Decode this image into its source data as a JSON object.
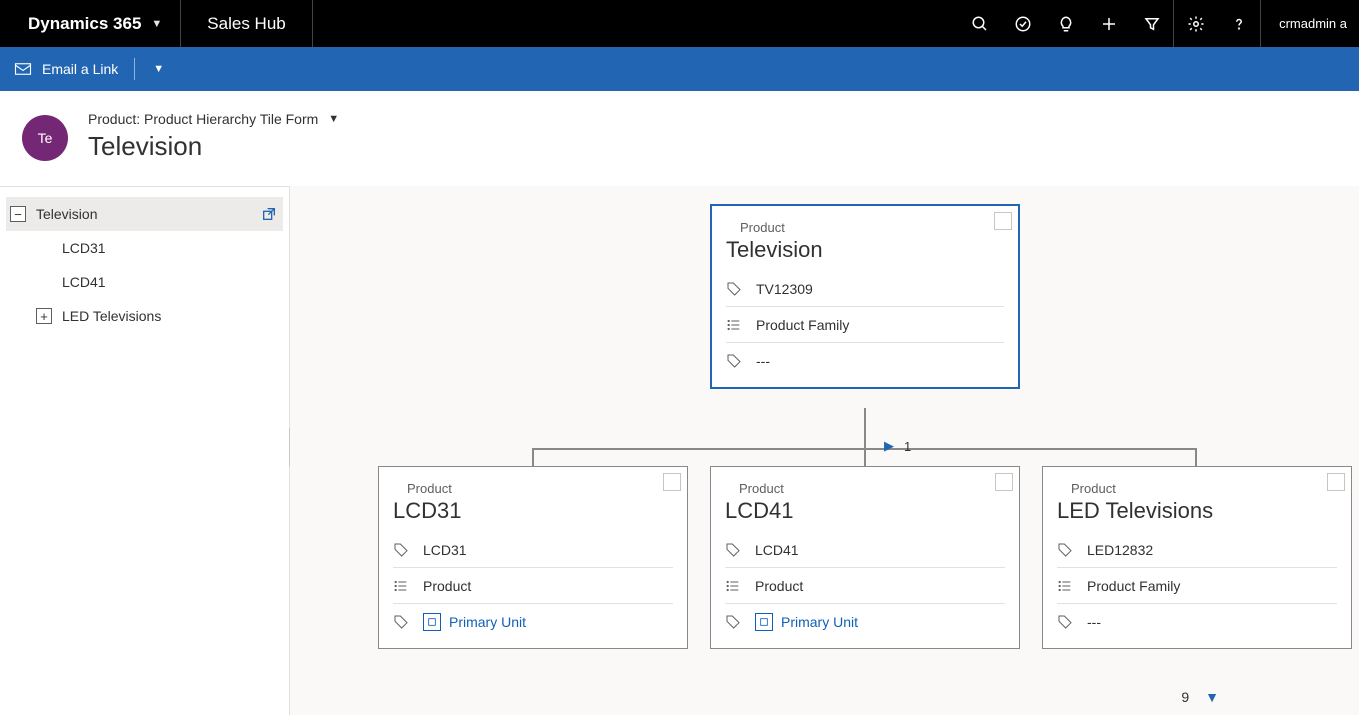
{
  "topbar": {
    "app_name": "Dynamics 365",
    "area_name": "Sales Hub",
    "user": "crmadmin a"
  },
  "cmdbar": {
    "email_link": "Email a Link"
  },
  "header": {
    "avatar_initials": "Te",
    "breadcrumb": "Product: Product Hierarchy Tile Form",
    "title": "Television"
  },
  "tree": {
    "items": [
      {
        "label": "Television",
        "level": 0,
        "toggle": "minus",
        "selected": true,
        "popout": true
      },
      {
        "label": "LCD31",
        "level": 1,
        "toggle": "none"
      },
      {
        "label": "LCD41",
        "level": 1,
        "toggle": "none"
      },
      {
        "label": "LED Televisions",
        "level": 1,
        "toggle": "plus"
      }
    ]
  },
  "canvas": {
    "pager_top": "1",
    "pager_bottom": "9",
    "root": {
      "type_label": "Product",
      "title": "Television",
      "row1": "TV12309",
      "row2": "Product Family",
      "row3": "---"
    },
    "children": [
      {
        "type_label": "Product",
        "title": "LCD31",
        "row1": "LCD31",
        "row2": "Product",
        "row3_link": "Primary Unit"
      },
      {
        "type_label": "Product",
        "title": "LCD41",
        "row1": "LCD41",
        "row2": "Product",
        "row3_link": "Primary Unit"
      },
      {
        "type_label": "Product",
        "title": "LED Televisions",
        "row1": "LED12832",
        "row2": "Product Family",
        "row3": "---"
      }
    ]
  }
}
